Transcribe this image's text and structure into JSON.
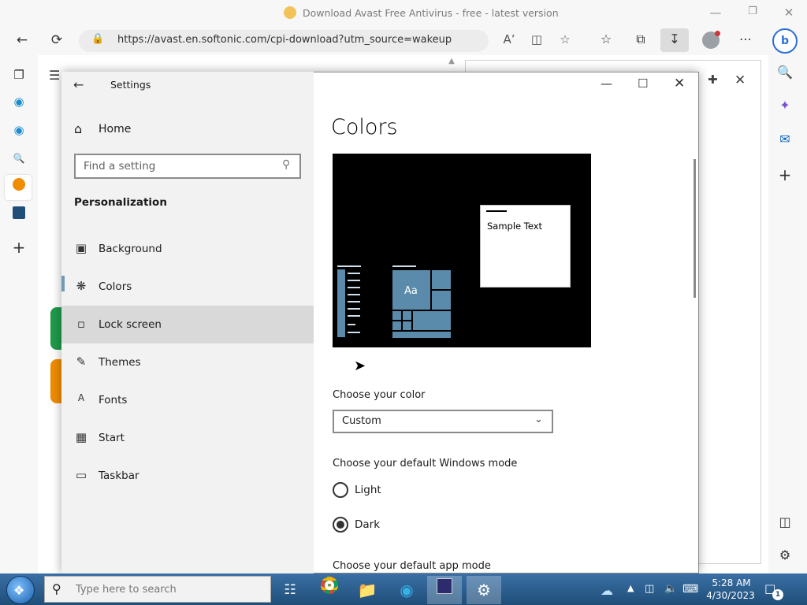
{
  "browser": {
    "tab_title": "Download Avast Free Antivirus - free - latest version",
    "url": "https://avast.en.softonic.com/cpi-download?utm_source=wakeup",
    "bing_label": "b"
  },
  "settings": {
    "window_title": "Settings",
    "home_label": "Home",
    "search_placeholder": "Find a setting",
    "section_title": "Personalization",
    "nav_items": [
      {
        "label": "Background",
        "icon": "image-icon"
      },
      {
        "label": "Colors",
        "icon": "palette-icon"
      },
      {
        "label": "Lock screen",
        "icon": "lock-screen-icon"
      },
      {
        "label": "Themes",
        "icon": "themes-icon"
      },
      {
        "label": "Fonts",
        "icon": "fonts-icon"
      },
      {
        "label": "Start",
        "icon": "start-icon"
      },
      {
        "label": "Taskbar",
        "icon": "taskbar-icon"
      }
    ],
    "fonts_icon_glyph": "A",
    "page_title": "Colors",
    "preview": {
      "sample_text": "Sample Text",
      "tile_label": "Aa",
      "accent": "#5b8bab"
    },
    "choose_color_label": "Choose your color",
    "choose_color_value": "Custom",
    "windows_mode_title": "Choose your default Windows mode",
    "windows_mode_options": [
      {
        "label": "Light",
        "selected": false
      },
      {
        "label": "Dark",
        "selected": true
      }
    ],
    "app_mode_title": "Choose your default app mode"
  },
  "taskbar": {
    "search_placeholder": "Type here to search",
    "time": "5:28 AM",
    "date": "4/30/2023",
    "notification_count": "1"
  },
  "colors": {
    "taskbar": "#1f4e78",
    "accent": "#5b8bab"
  }
}
